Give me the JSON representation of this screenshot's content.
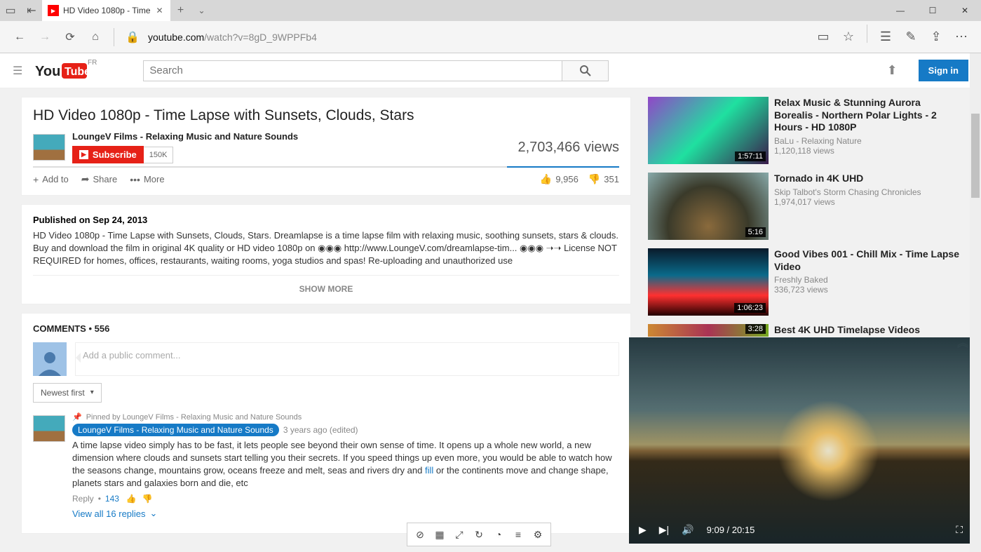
{
  "browser": {
    "tab_title": "HD Video 1080p - Time",
    "url": {
      "host": "youtube.com",
      "path": "/watch?v=8gD_9WPPFb4"
    }
  },
  "yt": {
    "locale": "FR",
    "search_placeholder": "Search",
    "signin": "Sign in"
  },
  "video": {
    "title": "HD Video 1080p - Time Lapse with Sunsets, Clouds, Stars",
    "channel": "LoungeV Films - Relaxing Music and Nature Sounds",
    "subscribe": "Subscribe",
    "sub_count": "150K",
    "views": "2,703,466 views",
    "actions": {
      "addto": "Add to",
      "share": "Share",
      "more": "More",
      "likes": "9,956",
      "dislikes": "351"
    }
  },
  "description": {
    "date": "Published on Sep 24, 2013",
    "text": "HD Video 1080p - Time Lapse with Sunsets, Clouds, Stars. Dreamlapse is a time lapse film with relaxing music, soothing sunsets, stars & clouds. Buy and download the film in original 4K quality or HD video 1080p on ◉◉◉ http://www.LoungeV.com/dreamlapse-tim... ◉◉◉ ➝➝ License NOT REQUIRED for homes, offices, restaurants, waiting rooms, yoga studios and spas! Re-uploading and unauthorized use",
    "show_more": "SHOW MORE"
  },
  "comments": {
    "header": "COMMENTS • 556",
    "placeholder": "Add a public comment...",
    "sort": "Newest first",
    "pinned_by": "Pinned by LoungeV Films - Relaxing Music and Nature Sounds",
    "author": "LoungeV Films - Relaxing Music and Nature Sounds",
    "time": "3 years ago (edited)",
    "text_a": "A time lapse video simply has to be fast, it lets people see beyond their own sense of time. It opens up a whole new world, a new dimension where clouds and sunsets start telling you their secrets. If you speed things up even more, you would be able to watch how the seasons change, mountains grow, oceans freeze and melt, seas and rivers dry and ",
    "text_link": "fill",
    "text_b": " or the continents move and change shape, planets stars and galaxies born and die, etc",
    "reply": "Reply",
    "reply_count": "143",
    "view_replies": "View all 16 replies"
  },
  "recs": [
    {
      "title": "Relax Music & Stunning Aurora Borealis - Northern Polar Lights - 2 Hours - HD 1080P",
      "channel": "BaLu - Relaxing Nature",
      "views": "1,120,118 views",
      "dur": "1:57:11"
    },
    {
      "title": "Tornado in 4K UHD",
      "channel": "Skip Talbot's Storm Chasing Chronicles",
      "views": "1,974,017 views",
      "dur": "5:16"
    },
    {
      "title": "Good Vibes 001 - Chill Mix - Time Lapse Video",
      "channel": "Freshly Baked",
      "views": "336,723 views",
      "dur": "1:06:23"
    },
    {
      "title": "Best 4K UHD Timelapse Videos",
      "channel": "",
      "views": "",
      "dur": "3:28"
    }
  ],
  "player": {
    "current": "9:09",
    "duration": "20:15"
  }
}
